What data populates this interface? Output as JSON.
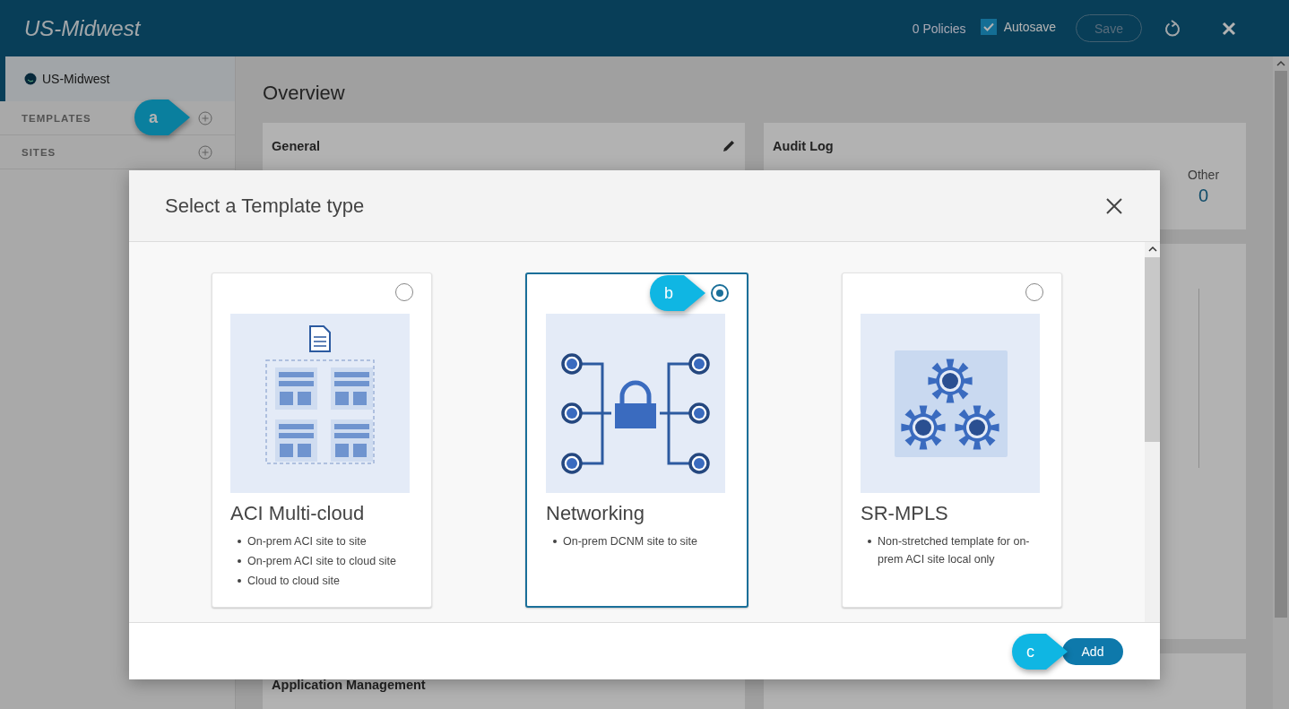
{
  "header": {
    "title": "US-Midwest",
    "policies": "0 Policies",
    "autosave": {
      "label": "Autosave",
      "checked": true
    },
    "save_button": {
      "label": "Save",
      "disabled": true
    }
  },
  "sidebar": {
    "schema": "US-Midwest",
    "sections": [
      {
        "label": "TEMPLATES",
        "callout": "a"
      },
      {
        "label": "SITES"
      }
    ]
  },
  "overview": {
    "title": "Overview",
    "general": "General",
    "audit_log": "Audit Log",
    "other": {
      "label": "Other",
      "value": "0"
    },
    "application_management": "Application Management"
  },
  "dialog": {
    "title": "Select a Template type",
    "cards": [
      {
        "kind": "multicloud",
        "title": "ACI Multi-cloud",
        "bullets": [
          "On-prem ACI site to site",
          "On-prem ACI site to cloud site",
          "Cloud to cloud site"
        ],
        "selected": false
      },
      {
        "kind": "networking",
        "title": "Networking",
        "bullets": [
          "On-prem DCNM site to site"
        ],
        "selected": true,
        "callout": "b"
      },
      {
        "kind": "srmpls",
        "title": "SR-MPLS",
        "bullets": [
          "Non-stretched template for on-prem ACI site local only"
        ],
        "selected": false
      }
    ],
    "add_button": {
      "label": "Add",
      "callout": "c"
    }
  }
}
